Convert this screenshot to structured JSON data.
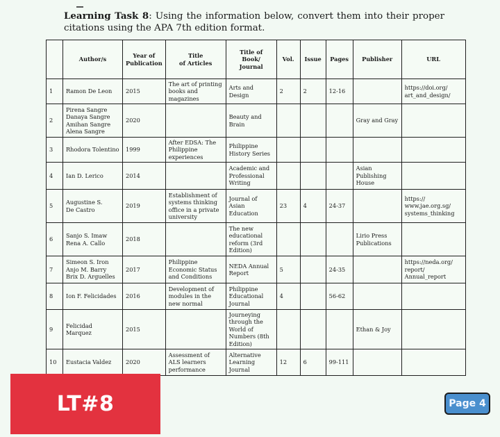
{
  "instruction": {
    "label": "Learning Task 8",
    "text": ": Using the information below, convert them into their proper citations using the APA 7th edition format."
  },
  "table": {
    "headers": {
      "num": "",
      "authors": "Author/s",
      "year_line1": "Year of",
      "year_line2": "Publication",
      "article_line1": "Title",
      "article_line2": "of Articles",
      "book_line1": "Title of",
      "book_line2": "Book/",
      "book_line3": "Journal",
      "vol": "Vol.",
      "issue": "Issue",
      "pages": "Pages",
      "publisher": "Publisher",
      "url": "URL"
    },
    "rows": [
      {
        "num": "1",
        "authors": "Ramon De Leon",
        "year": "2015",
        "article": "The art of printing books and magazines",
        "book": "Arts and Design",
        "vol": "2",
        "issue": "2",
        "pages": "12-16",
        "publisher": "",
        "url": "https://doi.org/ art_and_design/"
      },
      {
        "num": "2",
        "authors": "Pirena Sangre\nDanaya Sangre\nAmihan Sangre\nAlena Sangre",
        "year": "2020",
        "article": "",
        "book": "Beauty and Brain",
        "vol": "",
        "issue": "",
        "pages": "",
        "publisher": "Gray and Gray",
        "url": ""
      },
      {
        "num": "3",
        "authors": "Rhodora Tolentino",
        "year": "1999",
        "article": "After EDSA: The Philippine experiences",
        "book": "Philippine History Series",
        "vol": "",
        "issue": "",
        "pages": "",
        "publisher": "",
        "url": ""
      },
      {
        "num": "4",
        "authors": "Ian D. Lerico",
        "year": "2014",
        "article": "",
        "book": "Academic and Professional Writing",
        "vol": "",
        "issue": "",
        "pages": "",
        "publisher": "Asian Publishing House",
        "url": ""
      },
      {
        "num": "5",
        "authors": "Augustine S.\nDe Castro",
        "year": "2019",
        "article": "Establishment of systems thinking office in a private university",
        "book": "Journal of Asian Education",
        "vol": "23",
        "issue": "4",
        "pages": "24-37",
        "publisher": "",
        "url": "https:// www.jae.org.sg/ systems_thinking"
      },
      {
        "num": "6",
        "authors": "Sanjo S. Imaw\nRena A. Callo",
        "year": "2018",
        "article": "",
        "book": "The new educational reform (3rd Edition)",
        "vol": "",
        "issue": "",
        "pages": "",
        "publisher": "Lirio Press Publications",
        "url": ""
      },
      {
        "num": "7",
        "authors": "Simeon S. Iron\nAnjo M. Barry\nBrix D. Arguelles",
        "year": "2017",
        "article": "Philippine Economic Status and Conditions",
        "book": "NEDA Annual Report",
        "vol": "5",
        "issue": "",
        "pages": "24-35",
        "publisher": "",
        "url": "https://neda.org/ report/ Annual_report"
      },
      {
        "num": "8",
        "authors": "Ion F. Felicidades",
        "year": "2016",
        "article": "Development of modules in the new normal",
        "book": "Philippine Educational Journal",
        "vol": "4",
        "issue": "",
        "pages": "56-62",
        "publisher": "",
        "url": ""
      },
      {
        "num": "9",
        "authors": "Felicidad Marquez",
        "year": "2015",
        "article": "",
        "book": "Journeying through the World of Numbers (8th Edition)",
        "vol": "",
        "issue": "",
        "pages": "",
        "publisher": "Ethan & Joy",
        "url": ""
      },
      {
        "num": "10",
        "authors": "Eustacia Valdez",
        "year": "2020",
        "article": "Assessment of ALS learners performance",
        "book": "Alternative Learning Journal",
        "vol": "12",
        "issue": "6",
        "pages": "99-111",
        "publisher": "",
        "url": ""
      }
    ]
  },
  "banner": {
    "label": "LT#8",
    "color": "#e3323f"
  },
  "page_badge": {
    "label": "Page 4",
    "color": "#4a8fce"
  }
}
